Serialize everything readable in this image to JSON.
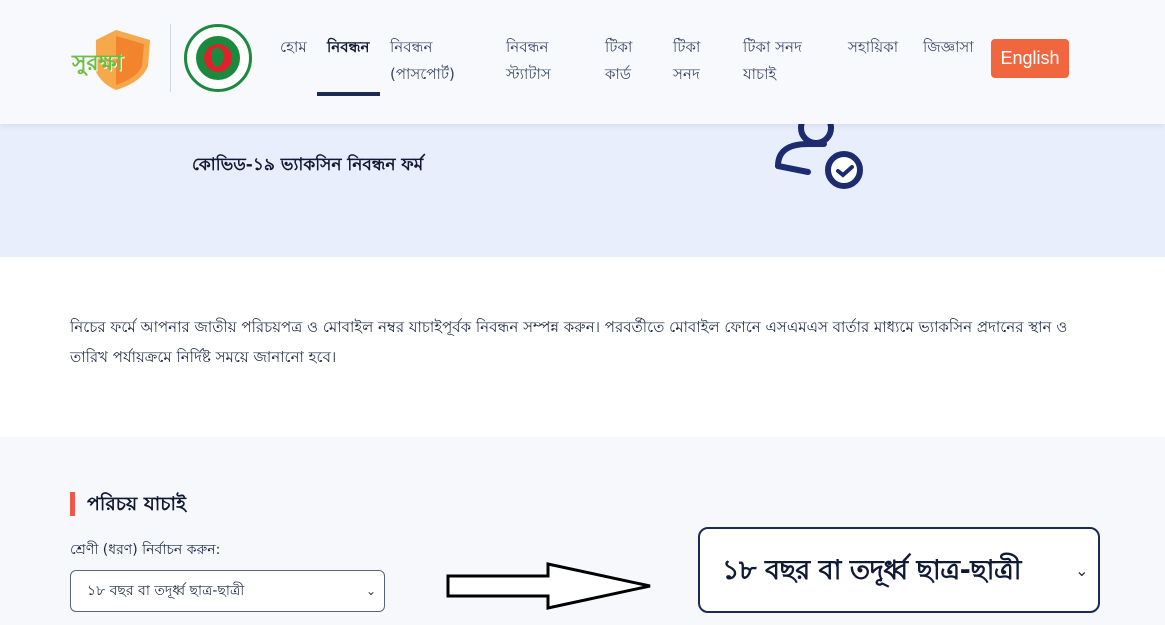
{
  "brand": {
    "logo_text": "সুরক্ষা"
  },
  "nav": {
    "items": [
      {
        "label": "হোম"
      },
      {
        "label": "নিবন্ধন"
      },
      {
        "label": "নিবন্ধন (পাসপোর্ট)"
      },
      {
        "label": "নিবন্ধন স্ট্যাটাস"
      },
      {
        "label": "টিকা কার্ড"
      },
      {
        "label": "টিকা সনদ"
      },
      {
        "label": "টিকা সনদ যাচাই"
      },
      {
        "label": "সহায়িকা"
      },
      {
        "label": "জিজ্ঞাসা"
      }
    ],
    "active_index": 1,
    "language_button": "English"
  },
  "hero": {
    "title": "কোভিড-১৯ ভ্যাকসিন নিবন্ধন ফর্ম"
  },
  "intro": {
    "text": "নিচের ফর্মে আপনার জাতীয় পরিচয়পত্র ও মোবাইল নম্বর যাচাইপূর্বক নিবন্ধন সম্পন্ন করুন। পরবর্তীতে মোবাইল ফোনে এসএমএস বার্তার মাধ্যমে ভ্যাকসিন প্রদানের স্থান ও তারিখ পর্যায়ক্রমে নির্দিষ্ট সময়ে জানানো হবে।"
  },
  "form": {
    "section_title": "পরিচয় যাচাই",
    "category_label": "শ্রেণী (ধরণ) নির্বাচন করুন:",
    "category_selected": "১৮ বছর বা তদূর্ধ্ব ছাত্র-ছাত্রী"
  },
  "zoom": {
    "selected": "১৮ বছর বা তদূর্ধ্ব ছাত্র-ছাত্রী"
  },
  "colors": {
    "accent": "#f0673f",
    "nav_active": "#1c2c55",
    "hero_bg": "#e8eefc",
    "section_marker": "#f0564a"
  },
  "icons": {
    "chevron": "chevron-down-icon",
    "arrow": "arrow-right-icon",
    "user_check": "user-check-icon"
  }
}
